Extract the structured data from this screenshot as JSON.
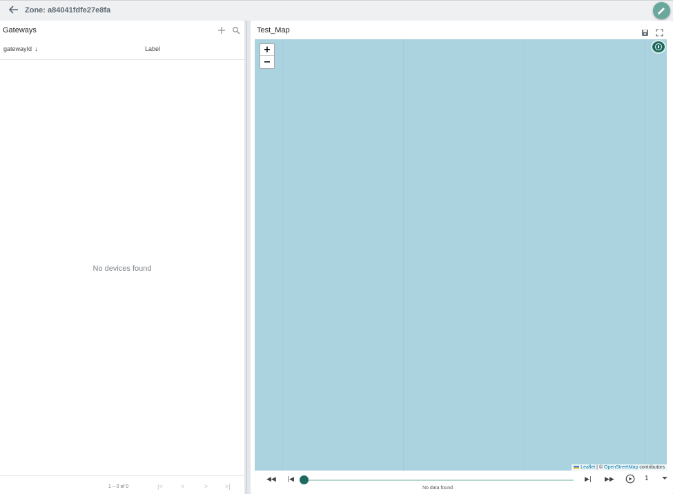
{
  "header": {
    "zone_title": "Zone: a84041fdfe27e8fa"
  },
  "gateways": {
    "title": "Gateways",
    "columns": [
      "gatewayId",
      "Label"
    ],
    "empty_message": "No devices found",
    "pagination": "1 – 0 of 0",
    "pager_buttons": [
      "|<",
      "<",
      ">",
      ">|"
    ]
  },
  "map": {
    "title": "Test_Map",
    "zoom_in": "+",
    "zoom_out": "−",
    "attribution": {
      "leaflet": "Leaflet",
      "sep": " | © ",
      "osm": "OpenStreetMap",
      "suffix": " contributors"
    },
    "timeline": {
      "no_data": "No data found",
      "speed": "1",
      "progress": 0
    }
  },
  "colors": {
    "accent": "#1e6a5f",
    "map_water": "#aad3df",
    "edit_fab": "#6aa79c"
  },
  "icons": [
    "arrow-back-icon",
    "pencil-icon",
    "add-icon",
    "search-icon",
    "save-icon",
    "fullscreen-icon",
    "info-icon",
    "fast-rewind-icon",
    "skip-previous-icon",
    "skip-next-icon",
    "fast-forward-icon",
    "play-circle-icon"
  ]
}
